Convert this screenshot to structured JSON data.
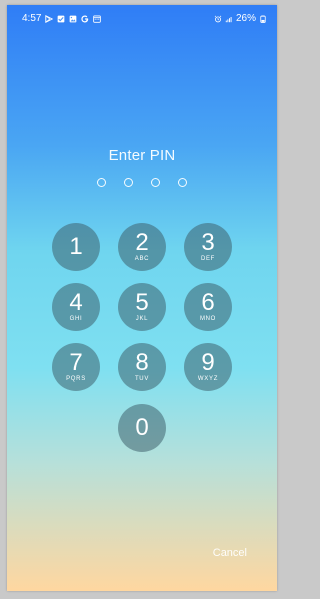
{
  "status_bar": {
    "time": "4:57",
    "battery": "26%",
    "left_icons": [
      "play-store-icon",
      "checkbox-notification-icon",
      "image-notification-icon",
      "google-icon",
      "calendar-icon"
    ],
    "right_icons": [
      "alarm-icon",
      "signal-icon",
      "battery-icon"
    ]
  },
  "pin_screen": {
    "title": "Enter PIN",
    "digit_slots": 4,
    "keys": [
      {
        "number": "1",
        "letters": ""
      },
      {
        "number": "2",
        "letters": "ABC"
      },
      {
        "number": "3",
        "letters": "DEF"
      },
      {
        "number": "4",
        "letters": "GHI"
      },
      {
        "number": "5",
        "letters": "JKL"
      },
      {
        "number": "6",
        "letters": "MNO"
      },
      {
        "number": "7",
        "letters": "PQRS"
      },
      {
        "number": "8",
        "letters": "TUV"
      },
      {
        "number": "9",
        "letters": "WXYZ"
      },
      {
        "number": "0",
        "letters": ""
      }
    ],
    "cancel_label": "Cancel"
  },
  "colors": {
    "gradient_top": "#2f7df6",
    "gradient_mid": "#7fe0f1",
    "gradient_bottom": "#ffd7a0",
    "key_fill": "#3c5c68"
  }
}
